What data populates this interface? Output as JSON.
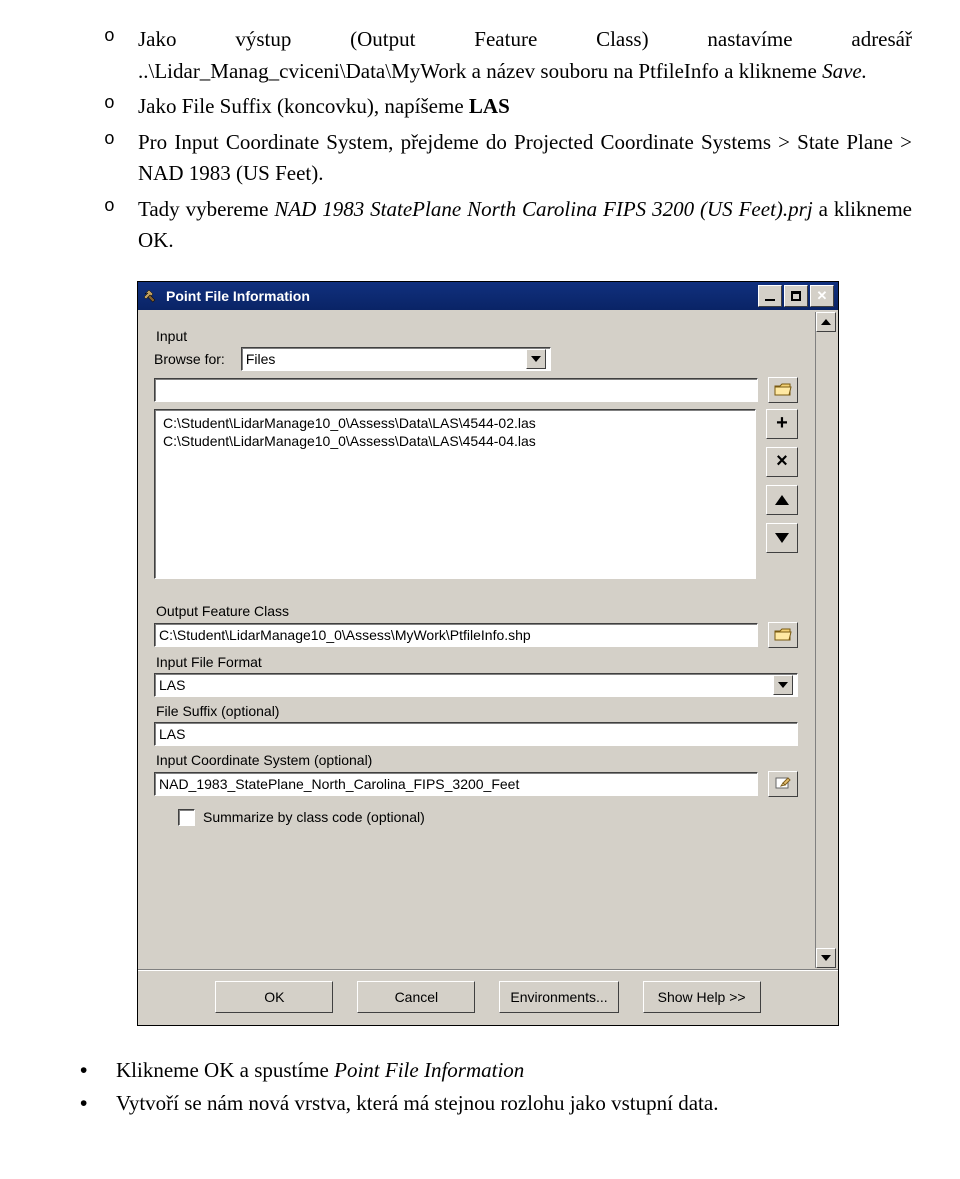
{
  "doc": {
    "b1a": "Jako výstup (Output Feature Class) nastavíme adresář ..\\Lidar_Manag_cviceni\\Data\\MyWork a název souboru na PtfileInfo a klikneme ",
    "b1b": "Save.",
    "b2a": "Jako File Suffix (koncovku), napíšeme ",
    "b2b": "LAS",
    "b3": "Pro Input Coordinate System, přejdeme do Projected Coordinate Systems > State Plane > NAD 1983 (US Feet).",
    "b4a": "Tady vybereme ",
    "b4b": "NAD 1983 StatePlane North Carolina FIPS 3200 (US Feet).prj",
    "b4c": "  a klikneme OK.",
    "foot1a": "Klikneme OK a spustíme ",
    "foot1b": "Point File Information",
    "foot2": "Vytvoří se nám nová vrstva, která má stejnou rozlohu jako vstupní data."
  },
  "dlg": {
    "title": "Point File Information",
    "input_label": "Input",
    "browse_label": "Browse for:",
    "browse_value": "Files",
    "list_items": [
      "C:\\Student\\LidarManage10_0\\Assess\\Data\\LAS\\4544-02.las",
      "C:\\Student\\LidarManage10_0\\Assess\\Data\\LAS\\4544-04.las"
    ],
    "out_label": "Output Feature Class",
    "out_value": "C:\\Student\\LidarManage10_0\\Assess\\MyWork\\PtfileInfo.shp",
    "fmt_label": "Input File Format",
    "fmt_value": "LAS",
    "suffix_label": "File Suffix (optional)",
    "suffix_value": "LAS",
    "crs_label": "Input Coordinate System (optional)",
    "crs_value": "NAD_1983_StatePlane_North_Carolina_FIPS_3200_Feet",
    "summarize_label": "Summarize by class code (optional)",
    "buttons": {
      "ok": "OK",
      "cancel": "Cancel",
      "env": "Environments...",
      "help": "Show Help >>"
    }
  }
}
